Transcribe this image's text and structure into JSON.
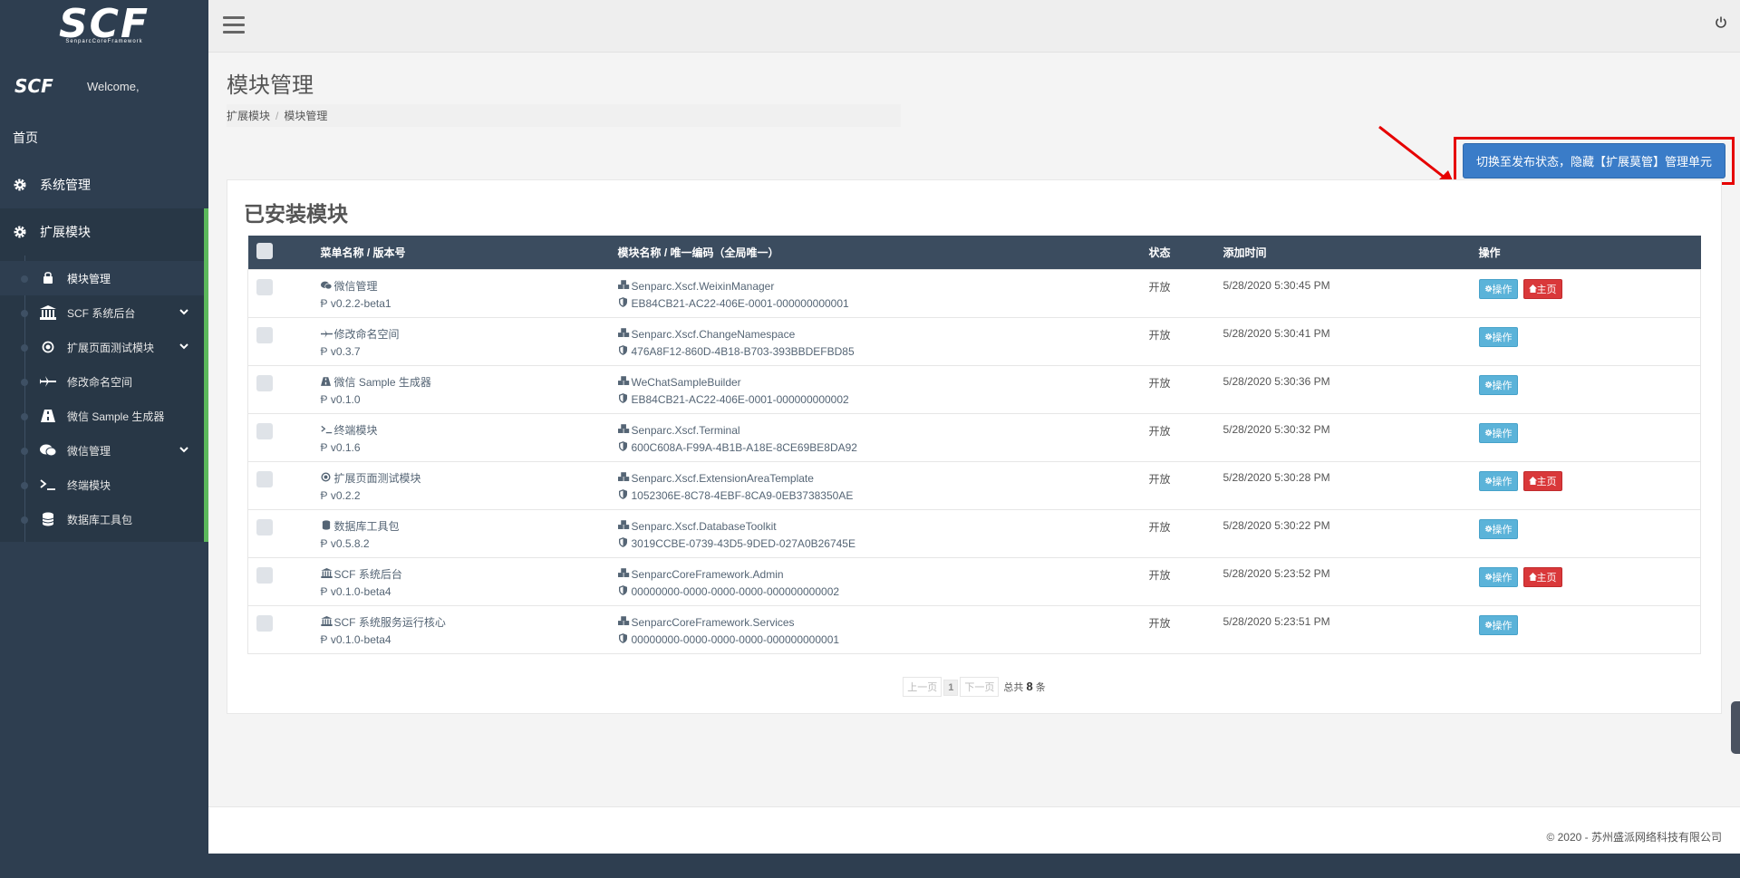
{
  "brand": {
    "logo": "SCF",
    "logo_sub": "SenparcCoreFramework",
    "small_logo": "SCF",
    "welcome": "Welcome,"
  },
  "sidebar": {
    "home": "首页",
    "system": "系统管理",
    "extension": "扩展模块",
    "sub_items": [
      {
        "label": "模块管理",
        "icon": "bag-icon",
        "active": true
      },
      {
        "label": "SCF 系统后台",
        "icon": "bank-icon",
        "chevron": true
      },
      {
        "label": "扩展页面测试模块",
        "icon": "dot-circle-icon",
        "chevron": true
      },
      {
        "label": "修改命名空间",
        "icon": "plane-icon"
      },
      {
        "label": "微信 Sample 生成器",
        "icon": "road-icon"
      },
      {
        "label": "微信管理",
        "icon": "wechat-icon",
        "chevron": true
      },
      {
        "label": "终端模块",
        "icon": "terminal-icon"
      },
      {
        "label": "数据库工具包",
        "icon": "database-icon"
      }
    ]
  },
  "header": {
    "title": "模块管理",
    "breadcrumb": [
      "扩展模块",
      "模块管理"
    ]
  },
  "actions": {
    "switch_label": "切换至发布状态，隐藏【扩展莫管】管理单元"
  },
  "installed": {
    "title": "已安装模块",
    "columns": [
      "菜单名称 / 版本号",
      "模块名称 / 唯一编码（全局唯一）",
      "状态",
      "添加时间",
      "操作"
    ],
    "rows": [
      {
        "menu": "微信管理",
        "menu_icon": "wechat-icon",
        "version": "v0.2.2-beta1",
        "module": "Senparc.Xscf.WeixinManager",
        "uid": "EB84CB21-AC22-406E-0001-000000000001",
        "status": "开放",
        "time": "5/28/2020 5:30:45 PM",
        "has_home": true
      },
      {
        "menu": "修改命名空间",
        "menu_icon": "plane-icon",
        "version": "v0.3.7",
        "module": "Senparc.Xscf.ChangeNamespace",
        "uid": "476A8F12-860D-4B18-B703-393BBDEFBD85",
        "status": "开放",
        "time": "5/28/2020 5:30:41 PM",
        "has_home": false
      },
      {
        "menu": "微信 Sample 生成器",
        "menu_icon": "road-icon",
        "version": "v0.1.0",
        "module": "WeChatSampleBuilder",
        "uid": "EB84CB21-AC22-406E-0001-000000000002",
        "status": "开放",
        "time": "5/28/2020 5:30:36 PM",
        "has_home": false
      },
      {
        "menu": "终端模块",
        "menu_icon": "terminal-icon",
        "version": "v0.1.6",
        "module": "Senparc.Xscf.Terminal",
        "uid": "600C608A-F99A-4B1B-A18E-8CE69BE8DA92",
        "status": "开放",
        "time": "5/28/2020 5:30:32 PM",
        "has_home": false
      },
      {
        "menu": "扩展页面测试模块",
        "menu_icon": "dot-circle-icon",
        "version": "v0.2.2",
        "module": "Senparc.Xscf.ExtensionAreaTemplate",
        "uid": "1052306E-8C78-4EBF-8CA9-0EB3738350AE",
        "status": "开放",
        "time": "5/28/2020 5:30:28 PM",
        "has_home": true
      },
      {
        "menu": "数据库工具包",
        "menu_icon": "database-icon",
        "version": "v0.5.8.2",
        "module": "Senparc.Xscf.DatabaseToolkit",
        "uid": "3019CCBE-0739-43D5-9DED-027A0B26745E",
        "status": "开放",
        "time": "5/28/2020 5:30:22 PM",
        "has_home": false
      },
      {
        "menu": "SCF 系统后台",
        "menu_icon": "bank-icon",
        "version": "v0.1.0-beta4",
        "module": "SenparcCoreFramework.Admin",
        "uid": "00000000-0000-0000-0000-000000000002",
        "status": "开放",
        "time": "5/28/2020 5:23:52 PM",
        "has_home": true
      },
      {
        "menu": "SCF 系统服务运行核心",
        "menu_icon": "bank-icon",
        "version": "v0.1.0-beta4",
        "module": "SenparcCoreFramework.Services",
        "uid": "00000000-0000-0000-0000-000000000001",
        "status": "开放",
        "time": "5/28/2020 5:23:51 PM",
        "has_home": false
      }
    ],
    "op_label": "操作",
    "home_label": "主页",
    "version_prefix": "Ᵽ"
  },
  "pager": {
    "prev": "上一页",
    "current": "1",
    "next": "下一页",
    "total_prefix": "总共",
    "total": "8",
    "total_suffix": "条"
  },
  "footer": {
    "text": "© 2020 - 苏州盛派网络科技有限公司"
  }
}
